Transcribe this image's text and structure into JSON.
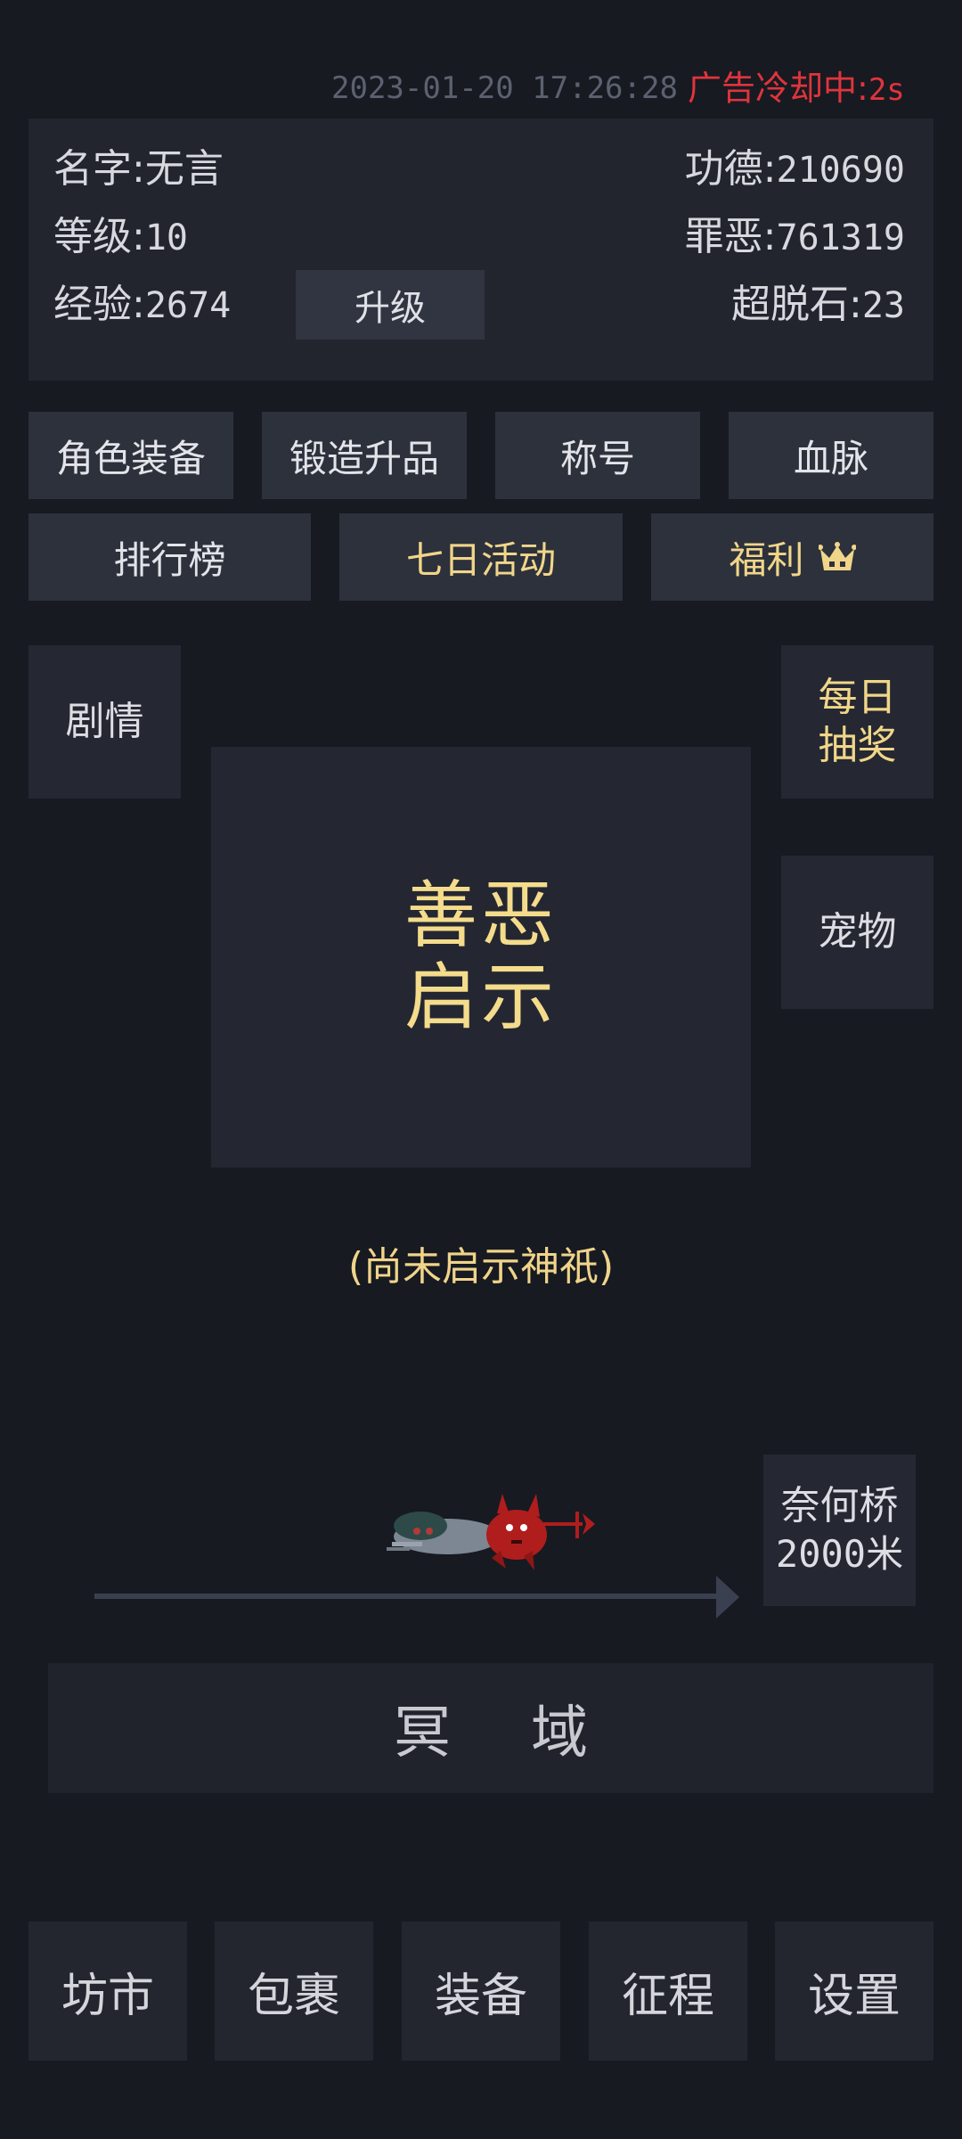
{
  "status": {
    "datetime": "2023-01-20 17:26:28",
    "ad_cooldown_label": "广告冷却中:",
    "ad_cooldown_value": "2s"
  },
  "profile": {
    "name_label": "名字:",
    "name_value": "无言",
    "level_label": "等级:",
    "level_value": "10",
    "exp_label": "经验:",
    "exp_value": "2674",
    "upgrade_label": "升级",
    "merit_label": "功德:",
    "merit_value": "210690",
    "sin_label": "罪恶:",
    "sin_value": "761319",
    "stone_label": "超脱石:",
    "stone_value": "23"
  },
  "menu_row1": [
    "角色装备",
    "锻造升品",
    "称号",
    "血脉"
  ],
  "menu_row2": [
    "排行榜",
    "七日活动",
    "福利"
  ],
  "side": {
    "story": "剧情",
    "daily_line1": "每日",
    "daily_line2": "抽奖",
    "pet": "宠物",
    "bridge_line1": "奈何桥",
    "bridge_line2": "2000米"
  },
  "center": {
    "line1": "善恶",
    "line2": "启示",
    "status_text": "(尚未启示神祇)"
  },
  "underworld_label": "冥域",
  "bottom_nav": [
    "坊市",
    "包裹",
    "装备",
    "征程",
    "设置"
  ],
  "icons": {
    "welfare": "crown-icon",
    "runner": "devil-and-ghost-sprite",
    "track_end": "arrow-right-icon"
  },
  "colors": {
    "background": "#171a21",
    "panel": "#22252e",
    "button": "#2d313c",
    "gold_text": "#f1d68a",
    "alert_red": "#e0343d"
  }
}
